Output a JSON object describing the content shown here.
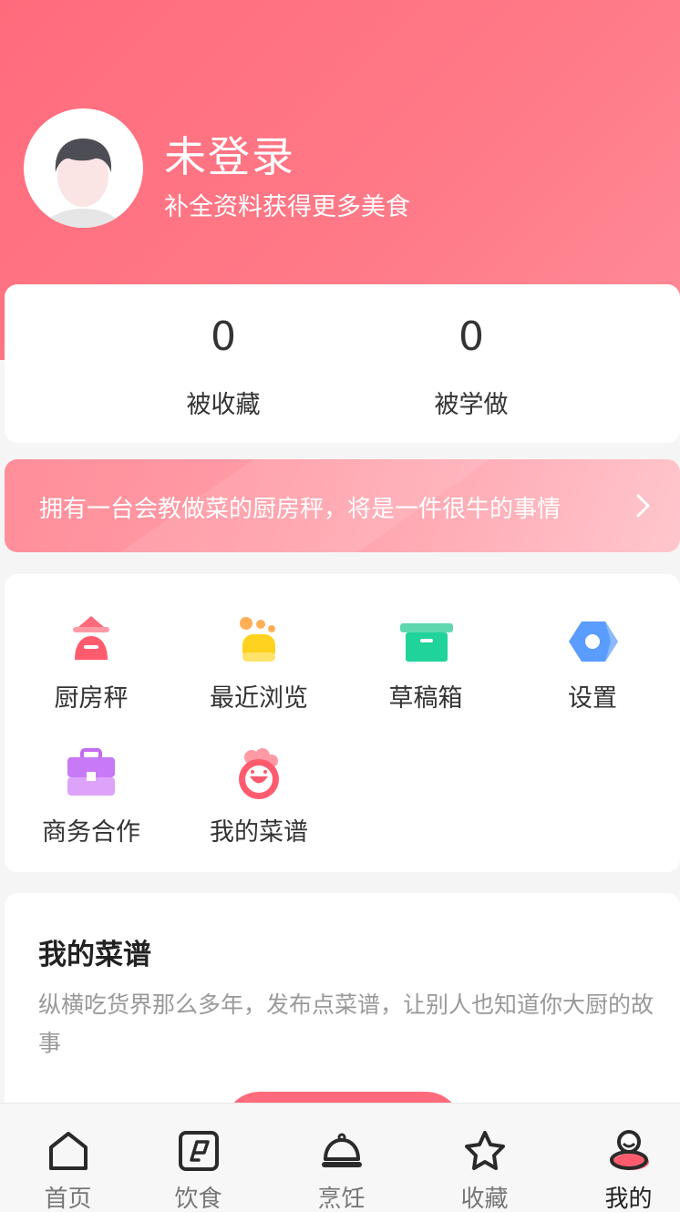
{
  "profile": {
    "name": "未登录",
    "subtitle": "补全资料获得更多美食"
  },
  "stats": [
    {
      "value": "0",
      "label": "被收藏"
    },
    {
      "value": "0",
      "label": "被学做"
    }
  ],
  "banner": {
    "text": "拥有一台会教做菜的厨房秤，将是一件很牛的事情"
  },
  "tools": [
    {
      "label": "厨房秤",
      "icon": "kitchen-scale-icon"
    },
    {
      "label": "最近浏览",
      "icon": "recent-browse-icon"
    },
    {
      "label": "草稿箱",
      "icon": "drafts-box-icon"
    },
    {
      "label": "设置",
      "icon": "settings-icon"
    },
    {
      "label": "商务合作",
      "icon": "business-briefcase-icon"
    },
    {
      "label": "我的菜谱",
      "icon": "chef-hat-icon"
    }
  ],
  "recipes": {
    "title": "我的菜谱",
    "description": "纵横吃货界那么多年，发布点菜谱，让别人也知道你大厨的故事"
  },
  "tabbar": [
    {
      "label": "首页",
      "icon": "home-icon"
    },
    {
      "label": "饮食",
      "icon": "diet-icon"
    },
    {
      "label": "烹饪",
      "icon": "cloche-icon"
    },
    {
      "label": "收藏",
      "icon": "star-icon"
    },
    {
      "label": "我的",
      "icon": "profile-icon",
      "active": true
    }
  ],
  "colors": {
    "accent": "#ff6b7c",
    "banner": "#ff9aa5"
  }
}
